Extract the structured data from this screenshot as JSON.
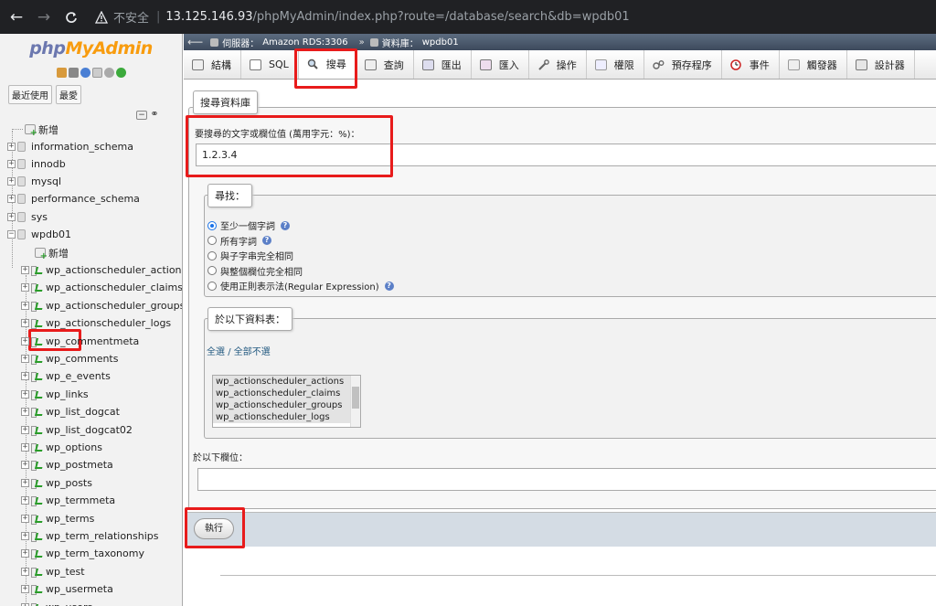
{
  "browser": {
    "back": "←",
    "forward": "→",
    "reload": "C",
    "insecure_label": "不安全",
    "separator": "|",
    "host": "13.125.146.93",
    "path": "/phpMyAdmin/index.php?route=/database/search&db=wpdb01"
  },
  "sidebar": {
    "logo_php": "php",
    "logo_myadmin": "MyAdmin",
    "recent_button": "最近使用",
    "favorites_button": "最愛",
    "new_label": "新增",
    "databases": [
      "information_schema",
      "innodb",
      "mysql",
      "performance_schema",
      "sys",
      "wpdb01"
    ],
    "wpdb01_new": "新增",
    "tables": [
      "wp_actionscheduler_actions",
      "wp_actionscheduler_claims",
      "wp_actionscheduler_groups",
      "wp_actionscheduler_logs",
      "wp_commentmeta",
      "wp_comments",
      "wp_e_events",
      "wp_links",
      "wp_list_dogcat",
      "wp_list_dogcat02",
      "wp_options",
      "wp_postmeta",
      "wp_posts",
      "wp_termmeta",
      "wp_terms",
      "wp_term_relationships",
      "wp_term_taxonomy",
      "wp_test",
      "wp_usermeta",
      "wp_users"
    ]
  },
  "breadcrumb": {
    "server_label": "伺服器：",
    "server": "Amazon RDS:3306",
    "arrow": "»",
    "db_label": "資料庫：",
    "db": "wpdb01"
  },
  "tabs": [
    "結構",
    "SQL",
    "搜尋",
    "查詢",
    "匯出",
    "匯入",
    "操作",
    "權限",
    "預存程序",
    "事件",
    "觸發器",
    "設計器"
  ],
  "search": {
    "legend": "搜尋資料庫",
    "prompt": "要搜尋的文字或欄位值 (萬用字元：%)：",
    "value": "1.2.3.4",
    "find_legend": "尋找：",
    "options": [
      "至少一個字詞",
      "所有字詞",
      "與子字串完全相同",
      "與整個欄位完全相同",
      "使用正則表示法(Regular Expression)"
    ],
    "selected_option": 0,
    "tables_legend": "於以下資料表：",
    "select_all": "全選",
    "slash": "/",
    "select_none": "全部不選",
    "table_list": [
      "wp_actionscheduler_actions",
      "wp_actionscheduler_claims",
      "wp_actionscheduler_groups",
      "wp_actionscheduler_logs"
    ],
    "column_label": "於以下欄位：",
    "column_value": "",
    "execute": "執行"
  },
  "colors": {
    "highlight": "#e81b1b",
    "browser_bg": "#202124",
    "breadcrumb_bg": "#4a5a6e"
  }
}
